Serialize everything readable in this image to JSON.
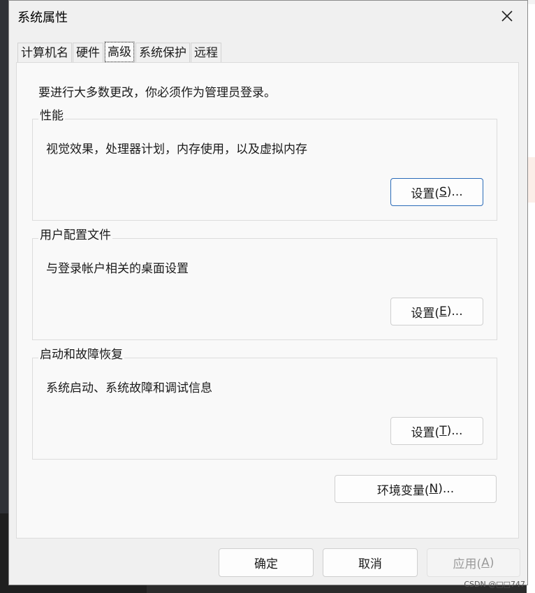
{
  "dialog": {
    "title": "系统属性",
    "close_icon": "close-icon"
  },
  "tabs": [
    {
      "label": "计算机名",
      "active": false
    },
    {
      "label": "硬件",
      "active": false
    },
    {
      "label": "高级",
      "active": true
    },
    {
      "label": "系统保护",
      "active": false
    },
    {
      "label": "远程",
      "active": false
    }
  ],
  "advanced": {
    "intro": "要进行大多数更改，你必须作为管理员登录。",
    "performance": {
      "title": "性能",
      "desc": "视觉效果，处理器计划，内存使用，以及虚拟内存",
      "button_pre": "设置(",
      "button_key": "S",
      "button_post": ")..."
    },
    "profiles": {
      "title": "用户配置文件",
      "desc": "与登录帐户相关的桌面设置",
      "button_pre": "设置(",
      "button_key": "E",
      "button_post": ")..."
    },
    "startup": {
      "title": "启动和故障恢复",
      "desc": "系统启动、系统故障和调试信息",
      "button_pre": "设置(",
      "button_key": "T",
      "button_post": ")..."
    },
    "env": {
      "button_pre": "环境变量(",
      "button_key": "N",
      "button_post": ")..."
    }
  },
  "footer": {
    "ok": "确定",
    "cancel": "取消",
    "apply_pre": "应用(",
    "apply_key": "A",
    "apply_post": ")"
  },
  "watermark": "CSDN @□□747"
}
